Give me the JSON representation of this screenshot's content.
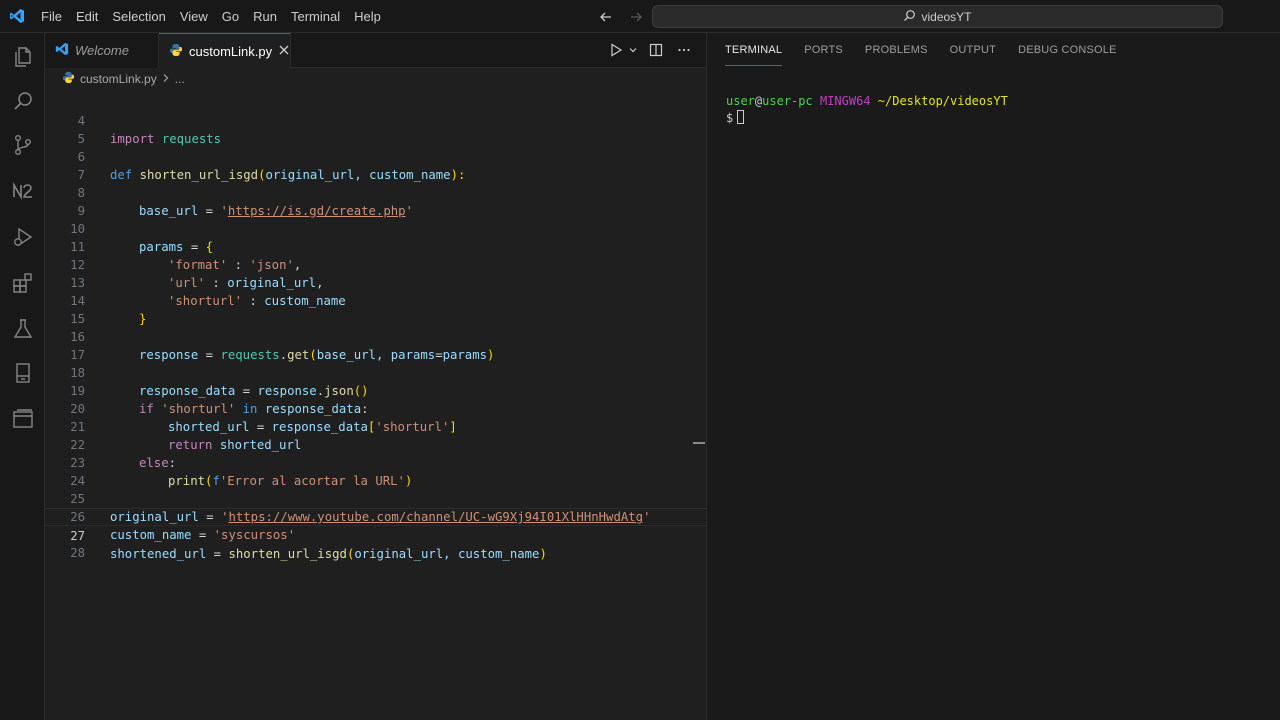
{
  "menu": [
    "File",
    "Edit",
    "Selection",
    "View",
    "Go",
    "Run",
    "Terminal",
    "Help"
  ],
  "command_center": "videosYT",
  "tabs": [
    {
      "label": "Welcome",
      "active": false
    },
    {
      "label": "customLink.py",
      "active": true
    }
  ],
  "breadcrumb": {
    "file": "customLink.py",
    "more": "..."
  },
  "editor": {
    "lines": [
      {
        "n": "4"
      },
      {
        "n": "5"
      },
      {
        "n": "6"
      },
      {
        "n": "7"
      },
      {
        "n": "8"
      },
      {
        "n": "9"
      },
      {
        "n": "10"
      },
      {
        "n": "11"
      },
      {
        "n": "12"
      },
      {
        "n": "13"
      },
      {
        "n": "14"
      },
      {
        "n": "15"
      },
      {
        "n": "16"
      },
      {
        "n": "17"
      },
      {
        "n": "18"
      },
      {
        "n": "19"
      },
      {
        "n": "20"
      },
      {
        "n": "21"
      },
      {
        "n": "22"
      },
      {
        "n": "23"
      },
      {
        "n": "24"
      },
      {
        "n": "25"
      },
      {
        "n": "26"
      },
      {
        "n": "27"
      },
      {
        "n": "28"
      }
    ],
    "current_line": "27",
    "code": {
      "l4_import": "import",
      "l4_module": "requests",
      "l6_def": "def",
      "l6_fn": "shorten_url_isgd",
      "l6_open": "(",
      "l6_params": "original_url, custom_name",
      "l6_close": "):",
      "l8_var": "base_url",
      "l8_eq": " = ",
      "l8_q1": "'",
      "l8_url": "https://is.gd/create.php",
      "l8_q2": "'",
      "l10_var": "params",
      "l10_eq": " = ",
      "l10_brace": "{",
      "l11_key": "'format'",
      "l11_sep": " : ",
      "l11_val": "'json'",
      "l11_comma": ",",
      "l12_key": "'url'",
      "l12_sep": " : ",
      "l12_val": "original_url",
      "l12_comma": ",",
      "l13_key": "'shorturl'",
      "l13_sep": " : ",
      "l13_val": "custom_name",
      "l14_brace": "}",
      "l16_var": "response",
      "l16_eq": " = ",
      "l16_mod": "requests",
      "l16_dot": ".",
      "l16_fn": "get",
      "l16_open": "(",
      "l16_args1": "base_url, ",
      "l16_args2": "params",
      "l16_args3": "=",
      "l16_args4": "params",
      "l16_close": ")",
      "l18_var": "response_data",
      "l18_eq": " = ",
      "l18_obj": "response",
      "l18_dot": ".",
      "l18_fn": "json",
      "l18_paren": "()",
      "l19_if": "if",
      "l19_str": " 'shorturl'",
      "l19_in": " in",
      "l19_var": " response_data",
      "l19_colon": ":",
      "l20_var": "shorted_url",
      "l20_eq": " = ",
      "l20_obj": "response_data",
      "l20_open": "[",
      "l20_str": "'shorturl'",
      "l20_close": "]",
      "l21_return": "return",
      "l21_var": " shorted_url",
      "l22_else": "else",
      "l22_colon": ":",
      "l23_fn": "print",
      "l23_open": "(",
      "l23_f": "f",
      "l23_str": "'Error al acortar la URL'",
      "l23_close": ")",
      "l25_var": "original_url",
      "l25_eq": " = ",
      "l25_q1": "'",
      "l25_url": "https://www.youtube.com/channel/UC-wG9Xj94I01XlHHnHwdAtg",
      "l25_q2": "'",
      "l26_var": "custom_name",
      "l26_eq": " = ",
      "l26_str": "'syscursos'",
      "l27_var": "shortened_url",
      "l27_eq": " = ",
      "l27_fn": "shorten_url_isgd",
      "l27_open": "(",
      "l27_args": "original_url, custom_name",
      "l27_close": ")"
    }
  },
  "panel": {
    "tabs": [
      "TERMINAL",
      "PORTS",
      "PROBLEMS",
      "OUTPUT",
      "DEBUG CONSOLE"
    ],
    "active_tab": "TERMINAL",
    "terminal": {
      "user": "user",
      "at": "@",
      "host": "user-pc",
      "env": "MINGW64",
      "path": "~/Desktop/videosYT",
      "prompt": "$"
    }
  },
  "colors": {
    "accent": "#0078d4",
    "keyword": "#c586c0",
    "function": "#dcdcaa",
    "variable": "#9cdcfe",
    "string": "#ce9178"
  }
}
